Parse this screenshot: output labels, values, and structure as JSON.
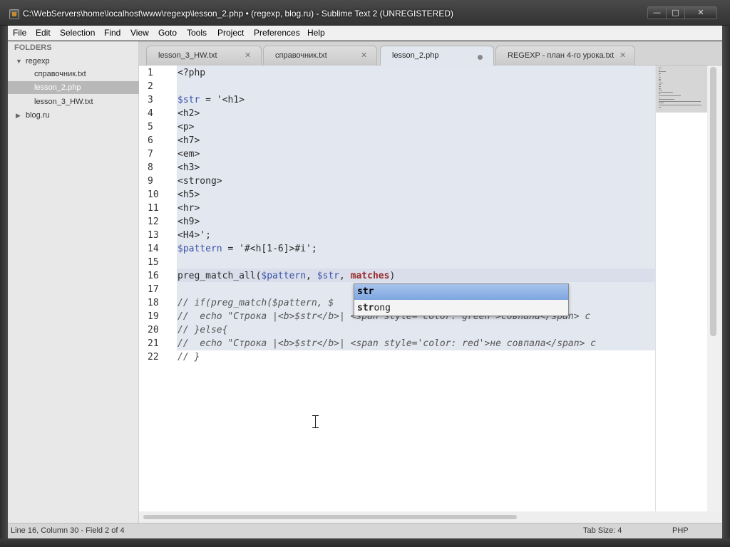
{
  "window": {
    "title": "C:\\WebServers\\home\\localhost\\www\\regexp\\lesson_2.php • (regexp, blog.ru) - Sublime Text 2 (UNREGISTERED)",
    "minimize_glyph": "—",
    "maximize_glyph": "□",
    "close_glyph": "✕"
  },
  "menu": {
    "items": [
      "File",
      "Edit",
      "Selection",
      "Find",
      "View",
      "Goto",
      "Tools",
      "Project",
      "Preferences",
      "Help"
    ]
  },
  "sidebar": {
    "header": "FOLDERS",
    "tree": [
      {
        "label": "regexp",
        "expanded_glyph": "▼"
      },
      {
        "label": "справочник.txt"
      },
      {
        "label": "lesson_2.php",
        "selected": true
      },
      {
        "label": "lesson_3_HW.txt"
      },
      {
        "label": "blog.ru",
        "collapsed_glyph": "▶"
      }
    ]
  },
  "tabs": [
    {
      "label": "lesson_3_HW.txt",
      "close": "✕"
    },
    {
      "label": "справочник.txt",
      "close": "✕"
    },
    {
      "label": "lesson_2.php",
      "active": true,
      "dirty": true
    },
    {
      "label": "REGEXP - план 4-го урока.txt",
      "close": "✕"
    }
  ],
  "editor": {
    "line_numbers": [
      "1",
      "2",
      "3",
      "4",
      "5",
      "6",
      "7",
      "8",
      "9",
      "10",
      "11",
      "12",
      "13",
      "14",
      "15",
      "16",
      "17",
      "18",
      "19",
      "20",
      "21",
      "22"
    ],
    "lines": [
      "<?php",
      "",
      "$str = '<h1>",
      "<h2>",
      "<p>",
      "<h7>",
      "<em>",
      "<h3>",
      "<strong>",
      "<h5>",
      "<hr>",
      "<h9>",
      "<H4>';",
      "$pattern = '#<h[1-6]>#i';",
      "",
      "preg_match_all($pattern, $str, matches)",
      "",
      "// if(preg_match($pattern, $",
      "//  echo \"Строка |<b>$str</b>| <span style='color: green'>совпала</span> с",
      "// }else{",
      "//  echo \"Строка |<b>$str</b>| <span style='color: red'>не совпала</span> с",
      "// }"
    ],
    "current_line": 16
  },
  "autocomplete": {
    "items": [
      {
        "match": "str",
        "rest": ""
      },
      {
        "match": "str",
        "rest": "ong"
      }
    ],
    "selected_index": 0
  },
  "status": {
    "position": "Line 16, Column 30 - Field 2 of 4",
    "tab_size": "Tab Size: 4",
    "syntax": "PHP"
  },
  "colors": {
    "selection_bg": "#e3e7f0",
    "autocomplete_selected": "#8fb0e6",
    "variable": "#3a52a8",
    "string": "#2a8a3a"
  }
}
